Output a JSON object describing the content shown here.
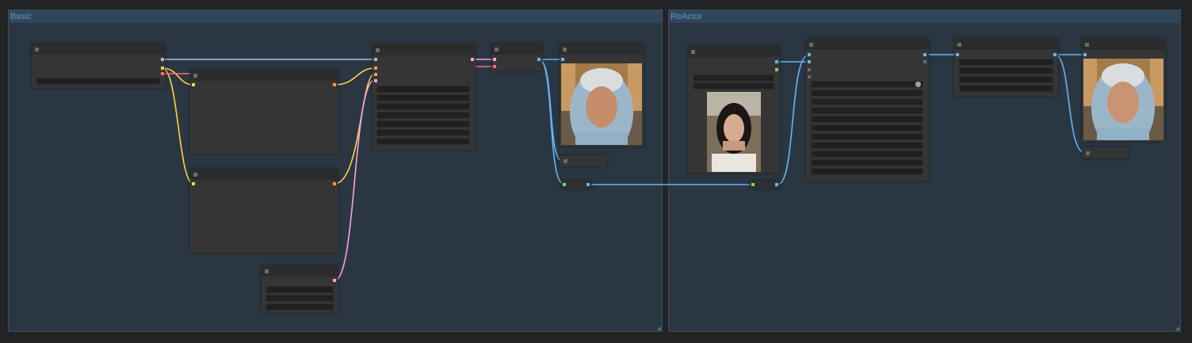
{
  "groups": [
    {
      "title": "Basic"
    },
    {
      "title": "ReActor"
    }
  ],
  "colors": {
    "background": "#222324",
    "group_fill": "#2a3742",
    "group_title": "#5d97c6",
    "node_body": "#353535",
    "link_clip": "#b5b3e9",
    "link_conditioning": "#ffd33d",
    "link_vae": "#ff6b6b",
    "link_latent": "#ff9ee8",
    "link_image": "#64b5f6",
    "link_face_model": "#7ed957"
  },
  "icons": {
    "node_collapse": "square-dot-icon",
    "widget_toggle": "circle-toggle-icon",
    "group_resize": "triangle-resize-icon"
  }
}
